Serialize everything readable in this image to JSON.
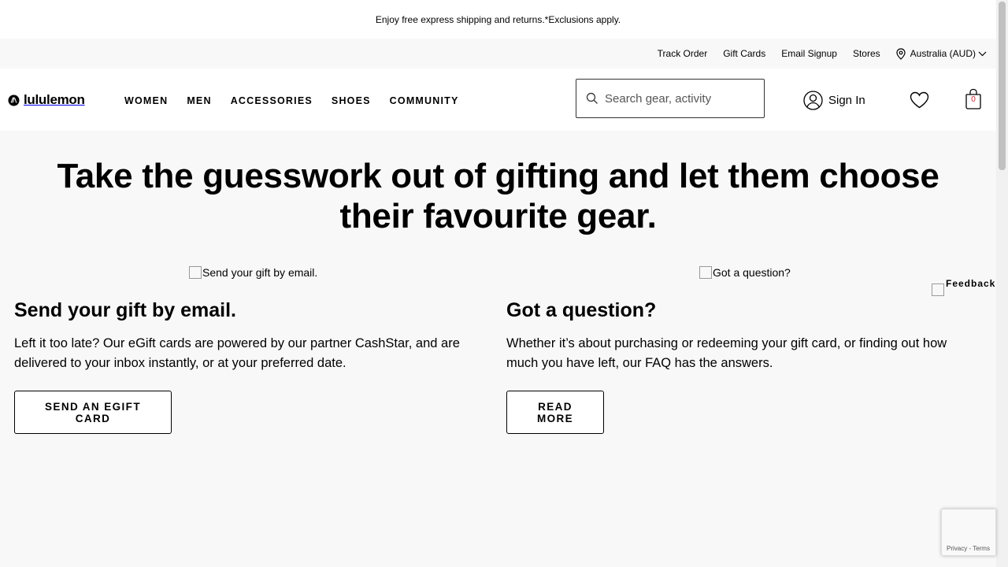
{
  "promo": {
    "text": "Enjoy free express shipping and returns.*Exclusions apply."
  },
  "utility": {
    "links": [
      "Track Order",
      "Gift Cards",
      "Email Signup",
      "Stores"
    ],
    "region": "Australia (AUD)",
    "icons": {
      "location": "map-pin-icon",
      "chevron": "chevron-down-icon"
    }
  },
  "header": {
    "logo_text": "lululemon",
    "nav": [
      "WOMEN",
      "MEN",
      "ACCESSORIES",
      "SHOES",
      "COMMUNITY"
    ],
    "search_placeholder": "Search gear, activity",
    "signin_label": "Sign In",
    "bag_count": "0"
  },
  "hero": {
    "headline": "Take the guesswork out of gifting and let them choose their favourite gear."
  },
  "cards": [
    {
      "image_alt": "Send your gift by email.",
      "title": "Send your gift by email.",
      "body": "Left it too late? Our eGift cards are powered by our partner CashStar, and are delivered to your inbox instantly, or at your preferred date.",
      "button": "SEND AN EGIFT CARD"
    },
    {
      "image_alt": "Got a question?",
      "title": "Got a question?",
      "body": "Whether it’s about purchasing or redeeming your gift card, or finding out how much you have left, our FAQ has the answers.",
      "button": "READ MORE"
    }
  ],
  "feedback": {
    "label": "Feedback"
  },
  "recaptcha": {
    "terms": "Privacy - Terms"
  },
  "colors": {
    "bag_count": "#d22030",
    "page_bg": "#f8f8f8"
  }
}
